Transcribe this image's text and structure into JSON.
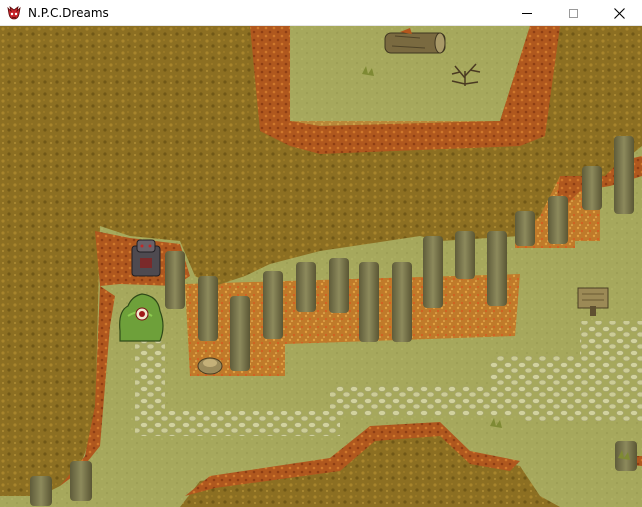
{
  "window": {
    "title": "N.P.C.Dreams",
    "app_icon": "red-goblin-face-icon",
    "controls": {
      "minimize": "minimize-icon",
      "maximize": "maximize-icon",
      "close": "close-icon"
    }
  },
  "scene": {
    "type": "top-down-rpg-map",
    "season": "autumn",
    "colors": {
      "grass": "#a4a659",
      "canopy": "#8a6e1f",
      "canopy_edge": "#b4561c",
      "trunk": "#7d7a4e",
      "path_stones": "#cfcf9a",
      "fallen_leaves": "#c9782a"
    },
    "objects": [
      {
        "name": "fallen-log",
        "icon": "log-icon"
      },
      {
        "name": "dead-bush",
        "icon": "dead-bush-icon"
      },
      {
        "name": "wooden-signpost",
        "icon": "sign-icon"
      },
      {
        "name": "stone-statue",
        "icon": "statue-icon"
      },
      {
        "name": "player-character",
        "icon": "green-slime-player-icon"
      },
      {
        "name": "tree-stump",
        "icon": "stump-icon"
      }
    ]
  }
}
